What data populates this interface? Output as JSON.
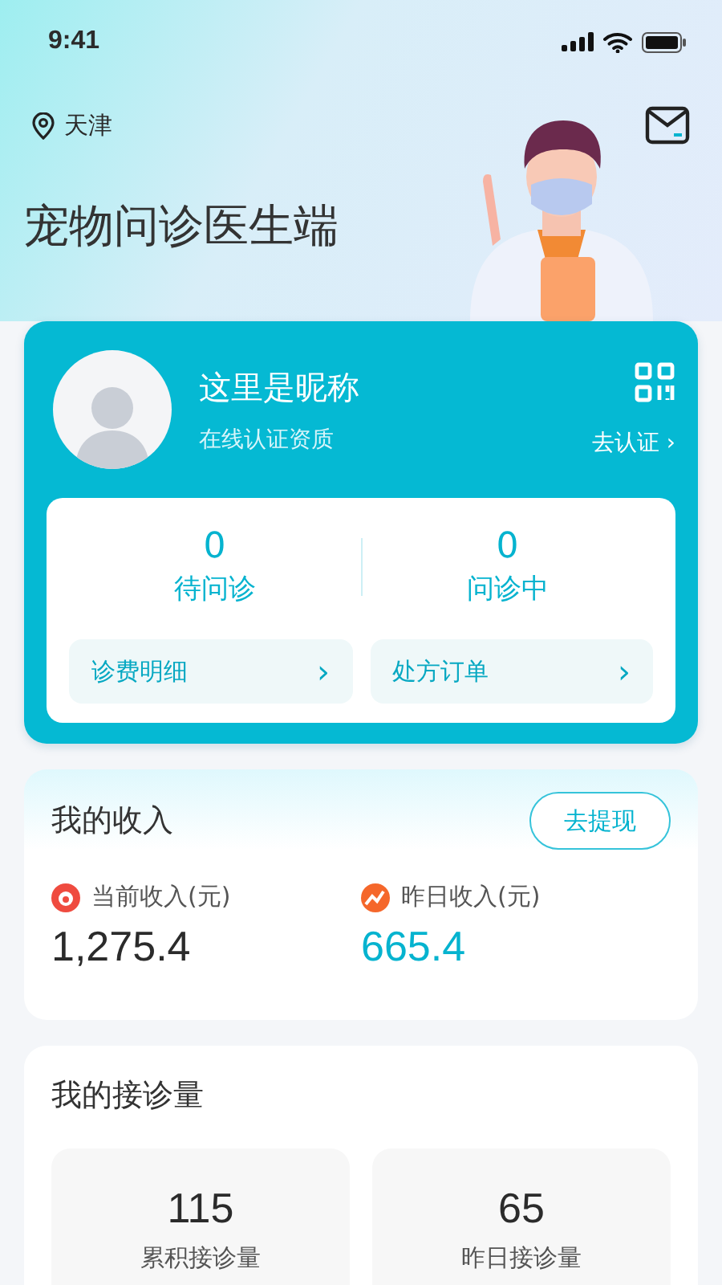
{
  "status_bar": {
    "time": "9:41"
  },
  "header": {
    "location": "天津",
    "title": "宠物问诊医生端"
  },
  "profile": {
    "nickname": "这里是昵称",
    "subtitle": "在线认证资质",
    "certify_link": "去认证",
    "chevron": "›",
    "counts": [
      {
        "value": "0",
        "label": "待问诊"
      },
      {
        "value": "0",
        "label": "问诊中"
      }
    ],
    "links": [
      {
        "label": "诊费明细"
      },
      {
        "label": "处方订单"
      }
    ]
  },
  "income": {
    "title": "我的收入",
    "withdraw_button": "去提现",
    "stats": [
      {
        "kind": "current",
        "label": "当前收入(元)",
        "value": "1,275.4",
        "color": "#ef4b3f"
      },
      {
        "kind": "yesterday",
        "label": "昨日收入(元)",
        "value": "665.4",
        "color": "#f5672b"
      }
    ]
  },
  "consultations": {
    "title": "我的接诊量",
    "stats": [
      {
        "value": "115",
        "label": "累积接诊量"
      },
      {
        "value": "65",
        "label": "昨日接诊量"
      }
    ]
  }
}
